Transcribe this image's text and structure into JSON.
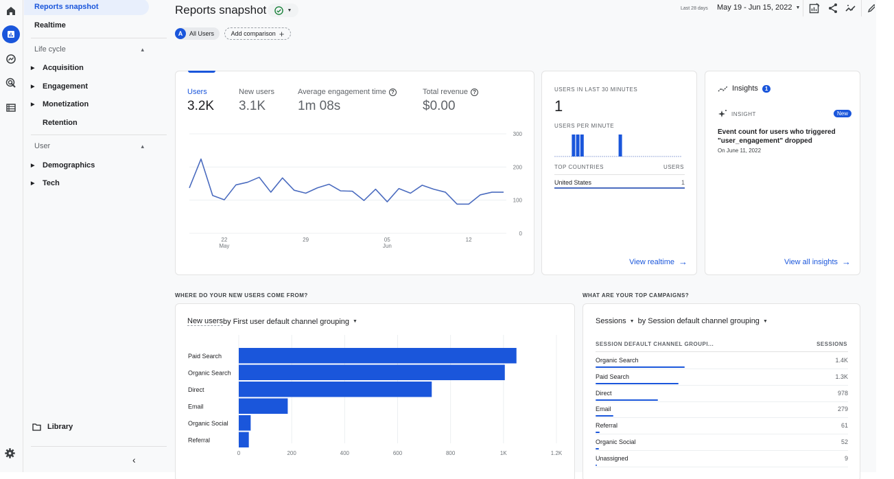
{
  "rail": {
    "items": [
      {
        "name": "home",
        "icon": "home-icon"
      },
      {
        "name": "reports",
        "icon": "bar-chart-icon",
        "active": true
      },
      {
        "name": "explore",
        "icon": "explore-icon"
      },
      {
        "name": "advertising",
        "icon": "target-icon"
      },
      {
        "name": "configure",
        "icon": "list-icon"
      }
    ],
    "settings_icon": "gear-icon"
  },
  "nav": {
    "reports_snapshot": "Reports snapshot",
    "realtime": "Realtime",
    "lifecycle": {
      "title": "Life cycle",
      "items": [
        "Acquisition",
        "Engagement",
        "Monetization",
        "Retention"
      ]
    },
    "user": {
      "title": "User",
      "items": [
        "Demographics",
        "Tech"
      ]
    },
    "library": "Library"
  },
  "header": {
    "title": "Reports snapshot",
    "comparison_chip": {
      "avatar": "A",
      "label": "All Users"
    },
    "add_comparison": "Add comparison",
    "date_label": "Last 28 days",
    "date_range": "May 19 - Jun 15, 2022"
  },
  "overview": {
    "metrics": [
      {
        "label": "Users",
        "value": "3.2K",
        "active": true
      },
      {
        "label": "New users",
        "value": "3.1K"
      },
      {
        "label": "Average engagement time",
        "value": "1m 08s",
        "help": true
      },
      {
        "label": "Total revenue",
        "value": "$0.00",
        "help": true
      }
    ]
  },
  "realtime": {
    "title": "USERS IN LAST 30 MINUTES",
    "value": "1",
    "per_minute_title": "USERS PER MINUTE",
    "per_minute": [
      0,
      0,
      0,
      0,
      1,
      1,
      1,
      0,
      0,
      0,
      0,
      0,
      0,
      0,
      0,
      1,
      0,
      0,
      0,
      0,
      0,
      0,
      0,
      0,
      0,
      0,
      0,
      0,
      0,
      0
    ],
    "countries_header": "TOP COUNTRIES",
    "users_header": "USERS",
    "countries": [
      {
        "name": "United States",
        "users": "1"
      }
    ],
    "link": "View realtime"
  },
  "insights": {
    "title": "Insights",
    "count": "1",
    "insight_label": "INSIGHT",
    "badge": "New",
    "text": "Event count for users who triggered \"user_engagement\" dropped",
    "date": "On June 11, 2022",
    "link": "View all insights"
  },
  "new_users_section": {
    "heading": "WHERE DO YOUR NEW USERS COME FROM?",
    "selector_metric": "New users",
    "selector_rest": " by First user default channel grouping"
  },
  "campaigns_section": {
    "heading": "WHAT ARE YOUR TOP CAMPAIGNS?",
    "selector_metric": "Sessions",
    "selector_rest": "by Session default channel grouping",
    "col1": "SESSION DEFAULT CHANNEL GROUPI...",
    "col2": "SESSIONS",
    "rows": [
      {
        "label": "Organic Search",
        "value": "1.4K",
        "num": 1400
      },
      {
        "label": "Paid Search",
        "value": "1.3K",
        "num": 1300
      },
      {
        "label": "Direct",
        "value": "978",
        "num": 978
      },
      {
        "label": "Email",
        "value": "279",
        "num": 279
      },
      {
        "label": "Referral",
        "value": "61",
        "num": 61
      },
      {
        "label": "Organic Social",
        "value": "52",
        "num": 52
      },
      {
        "label": "Unassigned",
        "value": "9",
        "num": 9
      }
    ]
  },
  "colors": {
    "accent": "#1a56db",
    "line": "#4a6bbf"
  },
  "chart_data": [
    {
      "type": "line",
      "title": "Users",
      "x": [
        "May 19",
        "May 20",
        "May 21",
        "May 22",
        "May 23",
        "May 24",
        "May 25",
        "May 26",
        "May 27",
        "May 28",
        "May 29",
        "May 30",
        "May 31",
        "Jun 1",
        "Jun 2",
        "Jun 3",
        "Jun 4",
        "Jun 5",
        "Jun 6",
        "Jun 7",
        "Jun 8",
        "Jun 9",
        "Jun 10",
        "Jun 11",
        "Jun 12",
        "Jun 13",
        "Jun 14",
        "Jun 15"
      ],
      "values": [
        137,
        224,
        114,
        101,
        146,
        154,
        169,
        124,
        167,
        130,
        121,
        137,
        148,
        128,
        127,
        99,
        133,
        95,
        135,
        121,
        145,
        133,
        124,
        88,
        88,
        116,
        124,
        124
      ],
      "xticks": [
        {
          "index": 3,
          "label": "22",
          "sub": "May"
        },
        {
          "index": 10,
          "label": "29",
          "sub": ""
        },
        {
          "index": 17,
          "label": "05",
          "sub": "Jun"
        },
        {
          "index": 24,
          "label": "12",
          "sub": ""
        }
      ],
      "yticks": [
        "0",
        "100",
        "200",
        "300"
      ],
      "ylim": [
        0,
        300
      ],
      "grid": true
    },
    {
      "type": "bar",
      "title": "New users by First user default channel grouping",
      "categories": [
        "Paid Search",
        "Organic Search",
        "Direct",
        "Email",
        "Organic Social",
        "Referral"
      ],
      "values": [
        1049,
        1005,
        729,
        185,
        45,
        38
      ],
      "xticks": [
        "0",
        "200",
        "400",
        "600",
        "800",
        "1K",
        "1.2K"
      ],
      "xlim": [
        0,
        1200
      ],
      "orientation": "horizontal",
      "grid": true
    }
  ]
}
